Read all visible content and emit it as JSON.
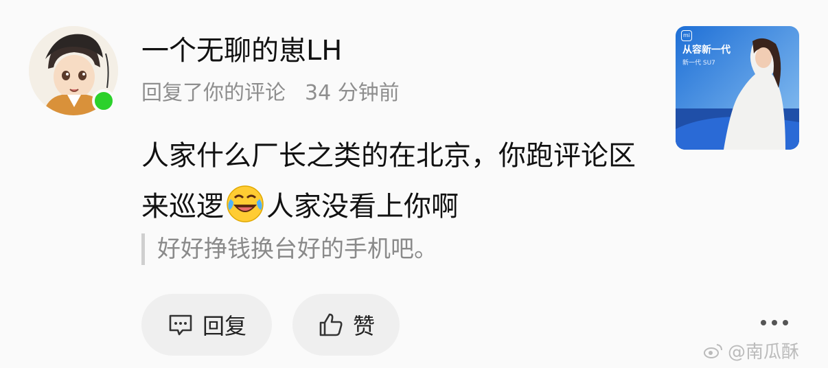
{
  "comment": {
    "username": "一个无聊的崽LH",
    "action": "回复了你的评论",
    "time": "34 分钟前",
    "text_before_emoji": "人家什么厂长之类的在北京，你跑评论区来巡逻",
    "emoji": "laughing-crying-emoji",
    "text_after_emoji": "人家没看上你啊",
    "quoted_text": "好好挣钱换台好的手机吧。"
  },
  "actions": {
    "reply_label": "回复",
    "like_label": "赞"
  },
  "thumbnail": {
    "brand_logo": "mi",
    "headline": "从容新一代",
    "subline": "新一代 SU7"
  },
  "watermark": {
    "text": "@南瓜酥"
  },
  "colors": {
    "online": "#2bd12b",
    "background": "#fafafa",
    "pill": "#efefef"
  }
}
